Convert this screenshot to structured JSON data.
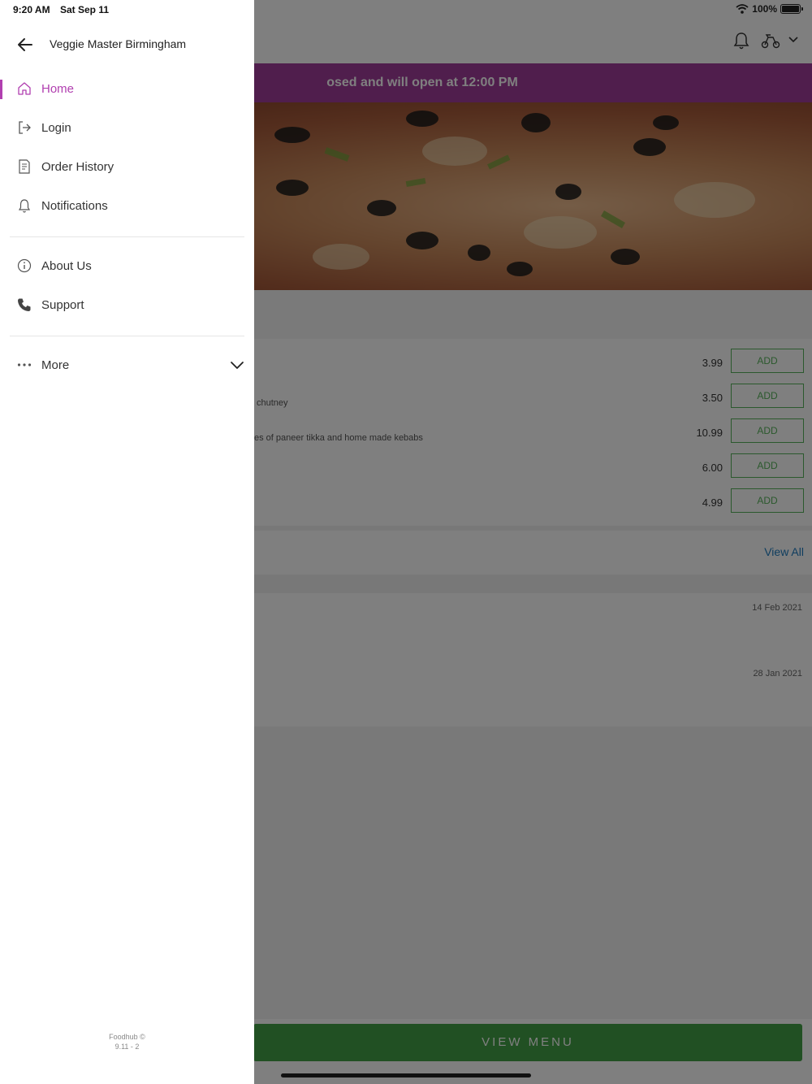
{
  "status_bar": {
    "time": "9:20 AM",
    "date": "Sat Sep 11",
    "battery": "100%"
  },
  "drawer": {
    "title": "Veggie Master Birmingham",
    "nav_primary": [
      {
        "label": "Home",
        "icon": "home-icon",
        "active": true
      },
      {
        "label": "Login",
        "icon": "login-icon"
      },
      {
        "label": "Order History",
        "icon": "receipt-icon"
      },
      {
        "label": "Notifications",
        "icon": "bell-icon"
      }
    ],
    "nav_secondary": [
      {
        "label": "About Us",
        "icon": "info-icon"
      },
      {
        "label": "Support",
        "icon": "phone-icon"
      }
    ],
    "more": {
      "label": "More",
      "icon": "more-dots-icon"
    },
    "footer": {
      "line1": "Foodhub ©",
      "line2": "9.11 - 2"
    }
  },
  "background": {
    "banner": "osed and will open at 12:00 PM",
    "menu_items": [
      {
        "price": "3.99",
        "add": "ADD",
        "desc": ""
      },
      {
        "price": "3.50",
        "add": "ADD",
        "desc": "chutney"
      },
      {
        "price": "10.99",
        "add": "ADD",
        "desc": "es of paneer tikka and home made kebabs"
      },
      {
        "price": "6.00",
        "add": "ADD",
        "desc": ""
      },
      {
        "price": "4.99",
        "add": "ADD",
        "desc": ""
      }
    ],
    "view_all": "View All",
    "orders": [
      {
        "date": "14 Feb 2021"
      },
      {
        "date": "28 Jan 2021"
      }
    ],
    "view_menu": "VIEW MENU"
  },
  "colors": {
    "accent": "#b13fb0",
    "banner": "#a13d9a",
    "primary_button": "#43a047",
    "link": "#1e7bbf"
  }
}
